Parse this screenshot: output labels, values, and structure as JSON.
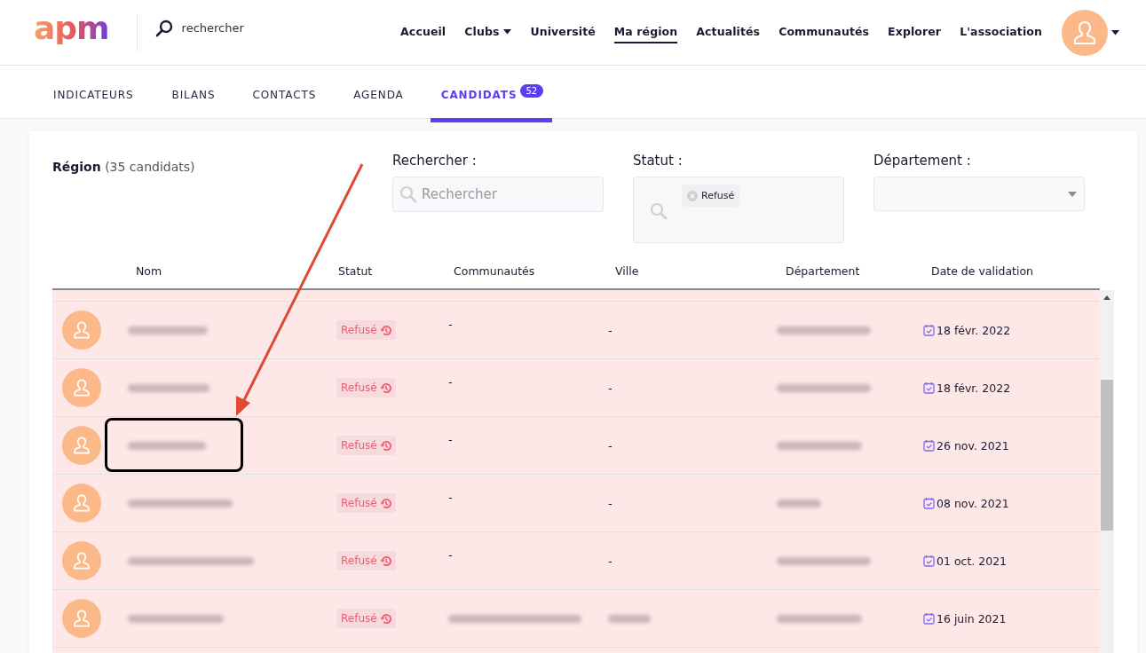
{
  "header": {
    "logo": "apm",
    "search": {
      "value": "rechercher"
    },
    "nav": [
      {
        "label": "Accueil",
        "selected": false,
        "dropdown": false
      },
      {
        "label": "Clubs",
        "selected": false,
        "dropdown": true
      },
      {
        "label": "Université",
        "selected": false,
        "dropdown": false
      },
      {
        "label": "Ma région",
        "selected": true,
        "dropdown": false
      },
      {
        "label": "Actualités",
        "selected": false,
        "dropdown": false
      },
      {
        "label": "Communautés",
        "selected": false,
        "dropdown": false
      },
      {
        "label": "Explorer",
        "selected": false,
        "dropdown": false
      },
      {
        "label": "L'association",
        "selected": false,
        "dropdown": false
      }
    ]
  },
  "tabs": [
    {
      "label": "INDICATEURS",
      "selected": false
    },
    {
      "label": "BILANS",
      "selected": false
    },
    {
      "label": "CONTACTS",
      "selected": false
    },
    {
      "label": "AGENDA",
      "selected": false
    },
    {
      "label": "CANDIDATS",
      "selected": true,
      "badge": "52"
    }
  ],
  "region": {
    "title": "Région",
    "count": "(35 candidats)"
  },
  "filters": {
    "search": {
      "label": "Rechercher :",
      "placeholder": "Rechercher"
    },
    "status": {
      "label": "Statut :",
      "tags": [
        "Refusé"
      ]
    },
    "department": {
      "label": "Département :"
    }
  },
  "table": {
    "columns": [
      "Nom",
      "Statut",
      "Communautés",
      "Ville",
      "Département",
      "Date de validation"
    ],
    "rows": [
      {
        "status": "Refusé",
        "communities": {
          "kind": "text",
          "text": "-"
        },
        "city": {
          "kind": "text",
          "text": "-"
        },
        "date": "18 févr. 2022"
      },
      {
        "status": "Refusé",
        "communities": {
          "kind": "text",
          "text": "-"
        },
        "city": {
          "kind": "text",
          "text": "-"
        },
        "date": "18 févr. 2022"
      },
      {
        "status": "Refusé",
        "communities": {
          "kind": "text",
          "text": "-"
        },
        "city": {
          "kind": "text",
          "text": "-"
        },
        "date": "26 nov. 2021"
      },
      {
        "status": "Refusé",
        "communities": {
          "kind": "text",
          "text": "-"
        },
        "city": {
          "kind": "text",
          "text": "-"
        },
        "date": "08 nov. 2021"
      },
      {
        "status": "Refusé",
        "communities": {
          "kind": "text",
          "text": "-"
        },
        "city": {
          "kind": "text",
          "text": "-"
        },
        "date": "01 oct. 2021"
      },
      {
        "status": "Refusé",
        "communities": {
          "kind": "redacted"
        },
        "city": {
          "kind": "redacted"
        },
        "date": "16 juin 2021"
      }
    ]
  }
}
